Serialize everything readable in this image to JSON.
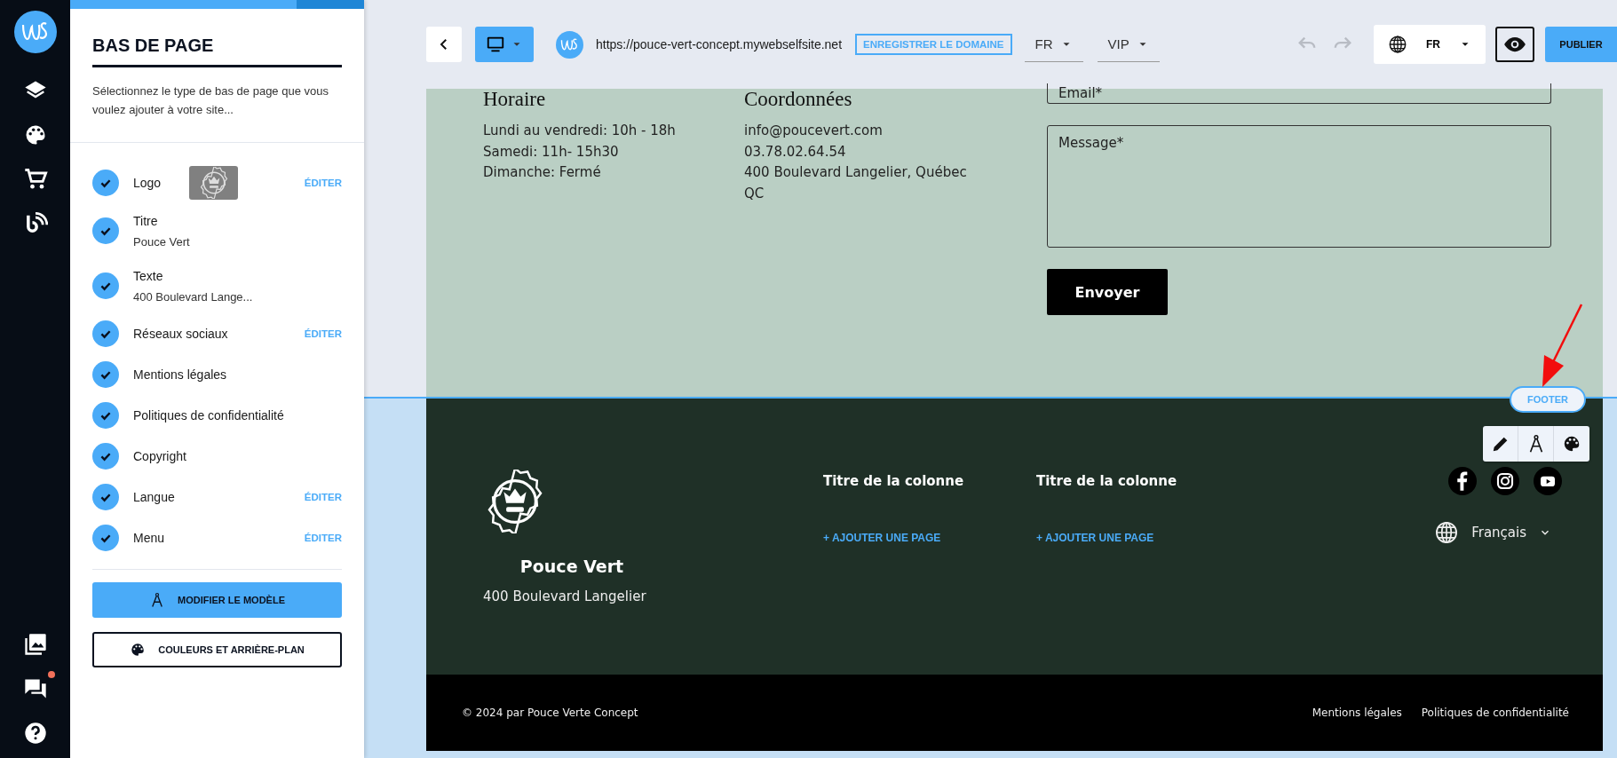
{
  "rail": {
    "items": [
      {
        "kind": "logo"
      },
      {
        "kind": "layers"
      },
      {
        "kind": "palette"
      },
      {
        "kind": "cart"
      },
      {
        "kind": "blog"
      },
      {
        "kind": "spacer"
      },
      {
        "kind": "gallery"
      },
      {
        "kind": "chat",
        "notification": true
      },
      {
        "kind": "help"
      }
    ]
  },
  "panel": {
    "progress": {
      "level": 0.77
    },
    "title": "BAS DE PAGE",
    "description": "Sélectionnez le type de bas de page que vous voulez ajouter à votre site...",
    "items": [
      {
        "label": "Logo",
        "checked": true,
        "kind": "logo",
        "action": "ÉDITER"
      },
      {
        "label": "Titre",
        "checked": true,
        "value": "Pouce Vert"
      },
      {
        "label": "Texte",
        "checked": true,
        "value": "400 Boulevard Lange..."
      },
      {
        "label": "Réseaux sociaux",
        "checked": true,
        "action": "ÉDITER"
      },
      {
        "label": "Mentions légales",
        "checked": true
      },
      {
        "label": "Politiques de confidentialité",
        "checked": true
      },
      {
        "label": "Copyright",
        "checked": true
      },
      {
        "label": "Langue",
        "checked": true,
        "action": "ÉDITER"
      },
      {
        "label": "Menu",
        "checked": true,
        "action": "ÉDITER"
      }
    ],
    "buttons": [
      {
        "label": "MODIFIER LE MODÈLE",
        "kind": "primary"
      },
      {
        "label": "COULEURS ET ARRIÈRE-PLAN",
        "kind": "outline"
      }
    ]
  },
  "toolbar": {
    "url": "https://pouce-vert-concept.mywebselfsite.net",
    "register_domain": "ENREGISTRER LE DOMAINE",
    "selects": [
      {
        "value": "FR"
      },
      {
        "value": "VIP"
      }
    ],
    "language": "FR",
    "publish": "PUBLIER"
  },
  "site": {
    "hours": {
      "title": "Horaire",
      "lines": [
        "Lundi au vendredi: 10h - 18h",
        "Samedi: 11h- 15h30",
        "Dimanche: Fermé"
      ]
    },
    "contact": {
      "title": "Coordonnées",
      "lines": [
        "info@poucevert.com",
        "03.78.02.64.54",
        "400 Boulevard Langelier, Québec QC"
      ]
    },
    "form": {
      "fields": [
        {
          "kind": "input",
          "placeholder": "Email*"
        },
        {
          "kind": "textarea",
          "placeholder": "Message*"
        }
      ],
      "submit": "Envoyer"
    },
    "footer": {
      "section_label": "FOOTER",
      "brand": "Pouce Vert",
      "address": "400 Boulevard Langelier",
      "columns": [
        {
          "title": "Titre de la colonne",
          "action": "+ AJOUTER UNE PAGE"
        },
        {
          "title": "Titre de la colonne",
          "action": "+ AJOUTER UNE PAGE"
        }
      ],
      "language": "Français",
      "copyright": "© 2024 par Pouce Verte Concept",
      "links": [
        "Mentions légales",
        "Politiques de confidentialité"
      ]
    }
  }
}
